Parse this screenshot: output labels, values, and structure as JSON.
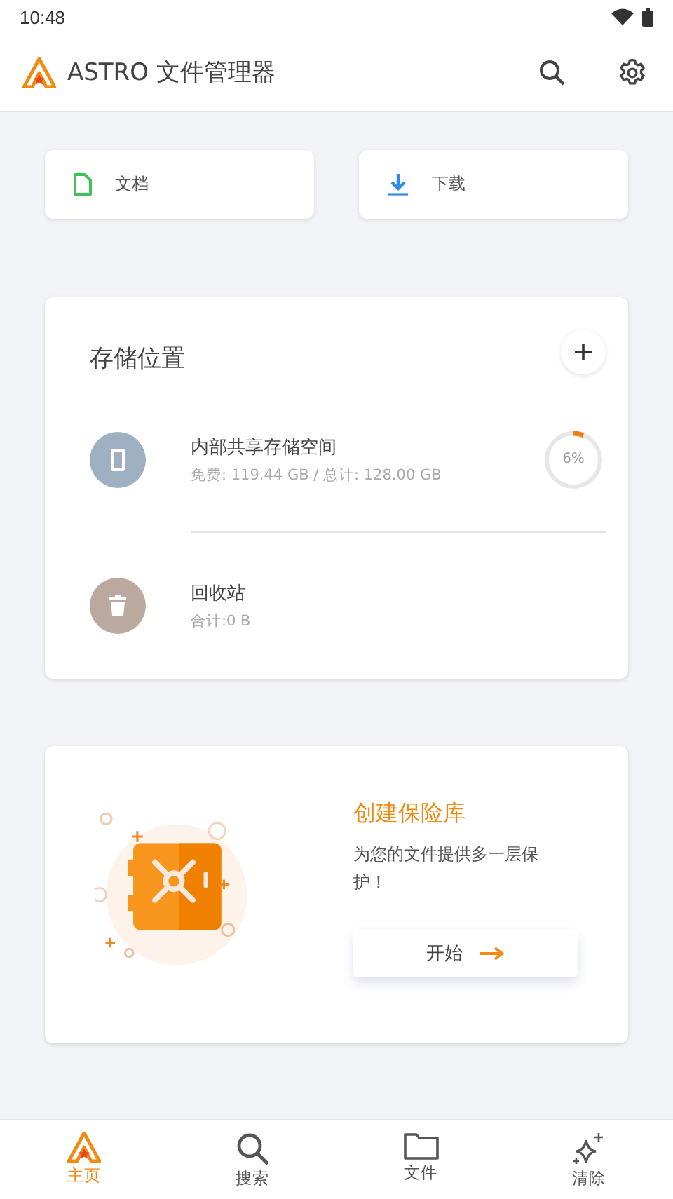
{
  "status_bar": {
    "time": "10:48"
  },
  "app_bar": {
    "title": "ASTRO 文件管理器"
  },
  "shortcuts": [
    {
      "kind": "document",
      "label": "文档"
    },
    {
      "kind": "download",
      "label": "下载"
    }
  ],
  "storage": {
    "title": "存储位置",
    "items": [
      {
        "kind": "phone",
        "name": "内部共享存储空间",
        "detail": "免费: 119.44 GB / 总计: 128.00 GB",
        "level": 0.06,
        "reading": "6%"
      },
      {
        "kind": "trash",
        "name": "回收站",
        "detail": "合计:0 B"
      }
    ]
  },
  "vault": {
    "title": "创建保险库",
    "description": "为您的文件提供多一层保护！",
    "button": "开始"
  },
  "bottom_nav": [
    {
      "kind": "home",
      "label": "主页",
      "selected": true
    },
    {
      "kind": "search",
      "label": "搜索",
      "selected": false
    },
    {
      "kind": "folder",
      "label": "文件",
      "selected": false
    },
    {
      "kind": "clean",
      "label": "清除",
      "selected": false
    }
  ]
}
